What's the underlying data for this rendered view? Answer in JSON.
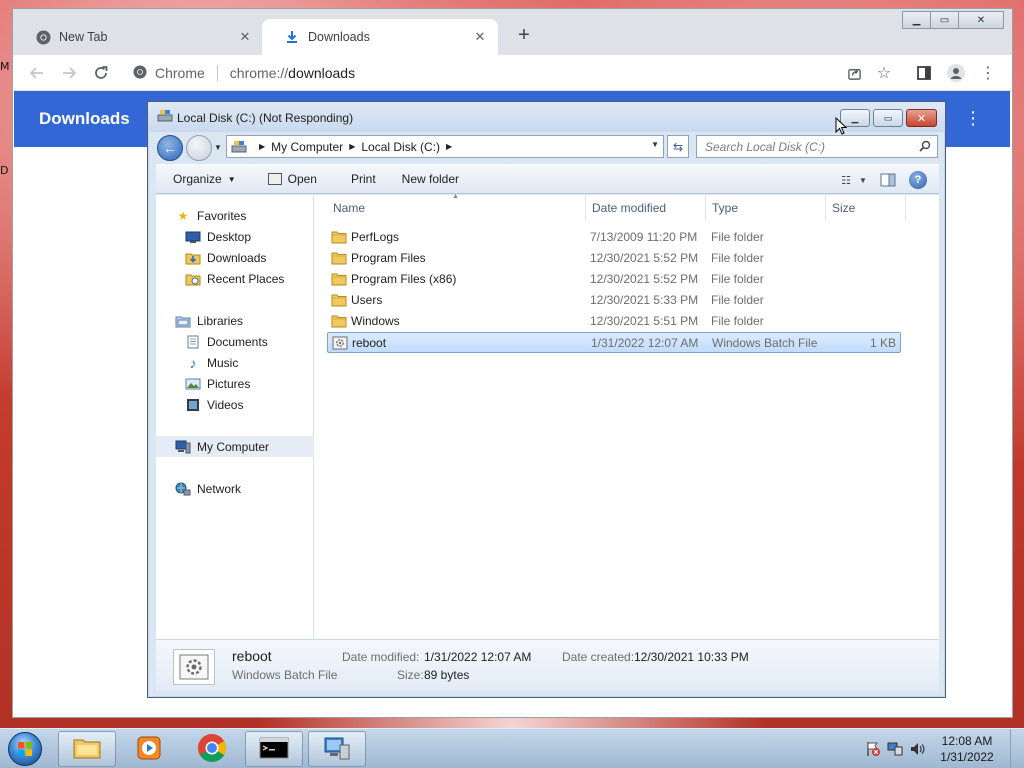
{
  "desktop": {
    "partial_icon_labels": [
      "M",
      "D"
    ]
  },
  "chrome": {
    "tabs": [
      {
        "label": "New Tab",
        "icon": "chrome-icon",
        "active": false
      },
      {
        "label": "Downloads",
        "icon": "download-icon",
        "active": true
      }
    ],
    "omnibox": {
      "chip": "Chrome",
      "url_scheme": "chrome://",
      "url_rest": "downloads"
    },
    "page_header_title": "Downloads"
  },
  "explorer": {
    "title": "Local Disk (C:) (Not Responding)",
    "breadcrumb": [
      "My Computer",
      "Local Disk (C:)"
    ],
    "search_placeholder": "Search Local Disk (C:)",
    "commands": {
      "organize": "Organize",
      "open": "Open",
      "print": "Print",
      "new_folder": "New folder"
    },
    "nav": {
      "favorites": "Favorites",
      "desktop": "Desktop",
      "downloads": "Downloads",
      "recent_places": "Recent Places",
      "libraries": "Libraries",
      "documents": "Documents",
      "music": "Music",
      "pictures": "Pictures",
      "videos": "Videos",
      "my_computer": "My Computer",
      "network": "Network"
    },
    "columns": {
      "name": "Name",
      "date_modified": "Date modified",
      "type": "Type",
      "size": "Size"
    },
    "files": [
      {
        "name": "PerfLogs",
        "date": "7/13/2009 11:20 PM",
        "type": "File folder",
        "size": "",
        "icon": "folder-icon"
      },
      {
        "name": "Program Files",
        "date": "12/30/2021 5:52 PM",
        "type": "File folder",
        "size": "",
        "icon": "folder-icon"
      },
      {
        "name": "Program Files (x86)",
        "date": "12/30/2021 5:52 PM",
        "type": "File folder",
        "size": "",
        "icon": "folder-icon"
      },
      {
        "name": "Users",
        "date": "12/30/2021 5:33 PM",
        "type": "File folder",
        "size": "",
        "icon": "folder-icon"
      },
      {
        "name": "Windows",
        "date": "12/30/2021 5:51 PM",
        "type": "File folder",
        "size": "",
        "icon": "folder-icon"
      },
      {
        "name": "reboot",
        "date": "1/31/2022 12:07 AM",
        "type": "Windows Batch File",
        "size": "1 KB",
        "icon": "batch-file-icon",
        "selected": true
      }
    ],
    "details": {
      "name": "reboot",
      "type": "Windows Batch File",
      "date_modified_label": "Date modified:",
      "date_modified": "1/31/2022 12:07 AM",
      "date_created_label": "Date created:",
      "date_created": "12/30/2021 10:33 PM",
      "size_label": "Size:",
      "size": "89 bytes"
    }
  },
  "taskbar": {
    "clock_time": "12:08 AM",
    "clock_date": "1/31/2022",
    "pinned": [
      "file-explorer-icon",
      "media-player-icon",
      "chrome-icon",
      "command-prompt-icon",
      "network-window-icon"
    ]
  },
  "colors": {
    "chrome_header": "#3367d6",
    "explorer_frame": "#dbe6f3",
    "selection": "#c1dcfc"
  }
}
